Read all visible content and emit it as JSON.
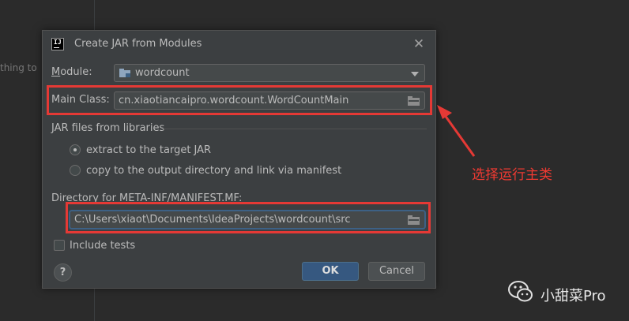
{
  "background": {
    "hint_text": "thing to"
  },
  "dialog": {
    "title": "Create JAR from Modules",
    "module_label": "Module:",
    "module_value": "wordcount",
    "main_class_label": "Main Class:",
    "main_class_value": "cn.xiaotiancaipro.wordcount.WordCountMain",
    "jar_files_label": "JAR files from libraries",
    "radio_extract": "extract to the target JAR",
    "radio_copy": "copy to the output directory and link via manifest",
    "manifest_label": "Directory for META-INF/MANIFEST.MF:",
    "manifest_value": "C:\\Users\\xiaot\\Documents\\IdeaProjects\\wordcount\\src",
    "include_tests": "Include tests",
    "help_label": "?",
    "ok_label": "OK",
    "cancel_label": "Cancel"
  },
  "annotation": {
    "text": "选择运行主类",
    "color": "#e53935"
  },
  "watermark": {
    "text": "小甜菜Pro"
  },
  "colors": {
    "dialog_bg": "#3c3f41",
    "ide_bg": "#2b2b2b",
    "primary_button": "#365880",
    "focus_border": "#3d6185"
  }
}
